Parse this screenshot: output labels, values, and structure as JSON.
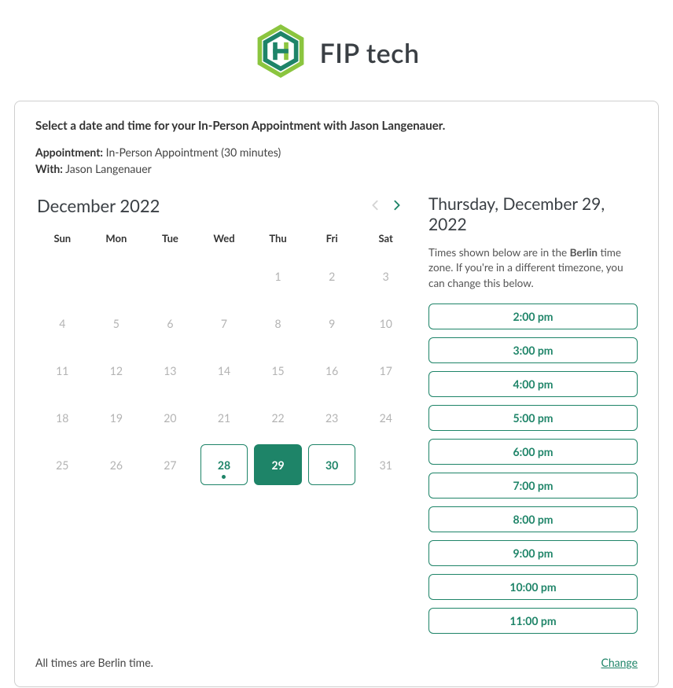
{
  "brand": {
    "name": "FIP tech"
  },
  "header": {
    "title": "Select a date and time for your In-Person Appointment with Jason Langenauer.",
    "appointment_label": "Appointment:",
    "appointment_value": "In-Person Appointment  (30 minutes)",
    "with_label": "With:",
    "with_value": "Jason Langenauer"
  },
  "calendar": {
    "month_title": "December 2022",
    "weekdays": [
      "Sun",
      "Mon",
      "Tue",
      "Wed",
      "Thu",
      "Fri",
      "Sat"
    ],
    "weeks": [
      [
        {
          "n": ""
        },
        {
          "n": ""
        },
        {
          "n": ""
        },
        {
          "n": ""
        },
        {
          "n": "1"
        },
        {
          "n": "2"
        },
        {
          "n": "3"
        }
      ],
      [
        {
          "n": "4"
        },
        {
          "n": "5"
        },
        {
          "n": "6"
        },
        {
          "n": "7"
        },
        {
          "n": "8"
        },
        {
          "n": "9"
        },
        {
          "n": "10"
        }
      ],
      [
        {
          "n": "11"
        },
        {
          "n": "12"
        },
        {
          "n": "13"
        },
        {
          "n": "14"
        },
        {
          "n": "15"
        },
        {
          "n": "16"
        },
        {
          "n": "17"
        }
      ],
      [
        {
          "n": "18"
        },
        {
          "n": "19"
        },
        {
          "n": "20"
        },
        {
          "n": "21"
        },
        {
          "n": "22"
        },
        {
          "n": "23"
        },
        {
          "n": "24"
        }
      ],
      [
        {
          "n": "25"
        },
        {
          "n": "26"
        },
        {
          "n": "27"
        },
        {
          "n": "28",
          "available": true,
          "dot": true
        },
        {
          "n": "29",
          "available": true,
          "selected": true
        },
        {
          "n": "30",
          "available": true
        },
        {
          "n": "31"
        }
      ]
    ]
  },
  "selected_date_title": "Thursday, December 29, 2022",
  "tz_note_prefix": "Times shown below are in the ",
  "tz_name": "Berlin",
  "tz_note_suffix": " time zone. If you're in a different timezone, you can change this below.",
  "slots": [
    "2:00 pm",
    "3:00 pm",
    "4:00 pm",
    "5:00 pm",
    "6:00 pm",
    "7:00 pm",
    "8:00 pm",
    "9:00 pm",
    "10:00 pm",
    "11:00 pm"
  ],
  "footer": {
    "tz_text": "All times are Berlin time.",
    "change_label": "Change"
  }
}
